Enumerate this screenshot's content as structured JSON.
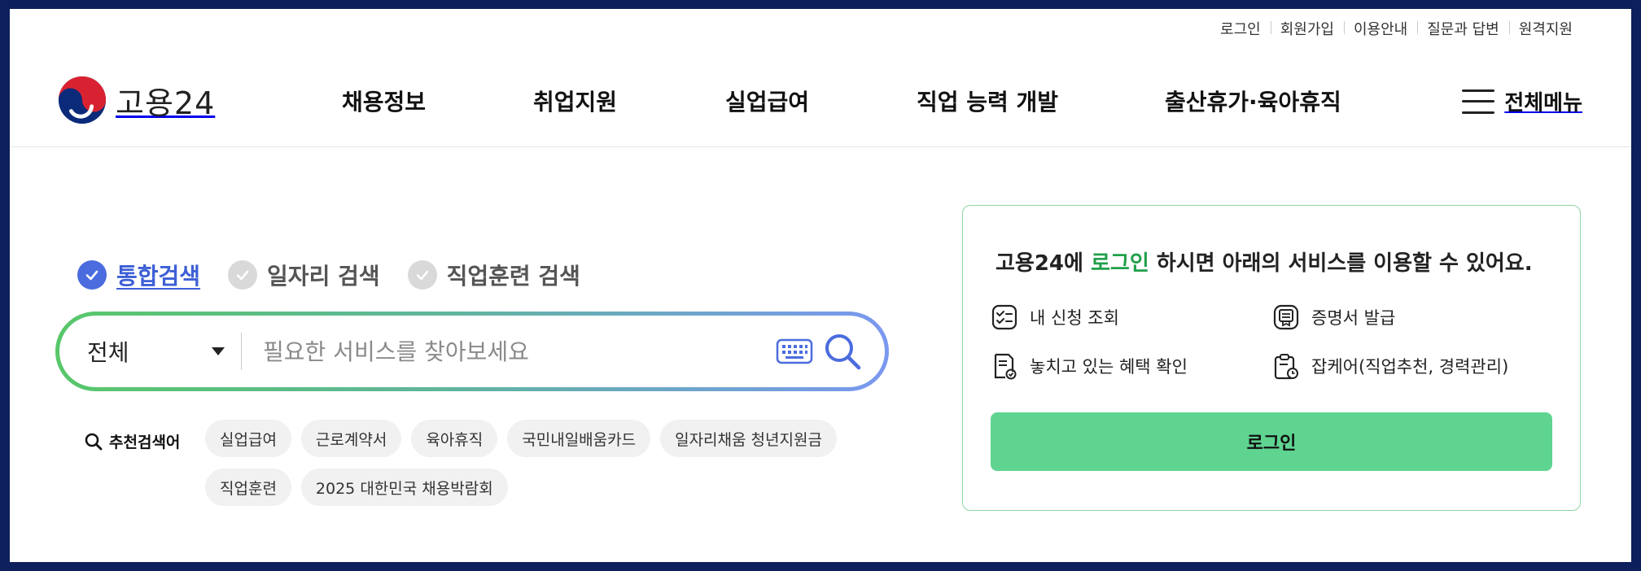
{
  "colors": {
    "frame": "#0d1f5c",
    "accent_blue": "#4b6cde",
    "accent_green": "#21a04a",
    "login_button": "#5fd491"
  },
  "utility_links": [
    "로그인",
    "회원가입",
    "이용안내",
    "질문과 답변",
    "원격지원"
  ],
  "logo": {
    "text": "고용24",
    "icon": "taegeuk-logo-icon"
  },
  "gnb": [
    "채용정보",
    "취업지원",
    "실업급여",
    "직업 능력 개발",
    "출산휴가·육아휴직"
  ],
  "menu_all": {
    "label": "전체메뉴",
    "icon": "hamburger-icon"
  },
  "search": {
    "tabs": [
      {
        "label": "통합검색",
        "active": true
      },
      {
        "label": "일자리 검색",
        "active": false
      },
      {
        "label": "직업훈련 검색",
        "active": false
      }
    ],
    "category": "전체",
    "placeholder": "필요한 서비스를 찾아보세요",
    "recommend_label": "추천검색어",
    "keywords": [
      "실업급여",
      "근로계약서",
      "육아휴직",
      "국민내일배움카드",
      "일자리채움 청년지원금",
      "직업훈련",
      "2025 대한민국 채용박람회"
    ]
  },
  "login_panel": {
    "title_before": "고용24에 ",
    "title_highlight": "로그인",
    "title_after": " 하시면 아래의 서비스를 이용할 수 있어요.",
    "services": [
      {
        "label": "내 신청 조회",
        "icon": "checklist-icon"
      },
      {
        "label": "증명서 발급",
        "icon": "certificate-icon"
      },
      {
        "label": "놓치고 있는 혜택 확인",
        "icon": "benefit-document-icon"
      },
      {
        "label": "잡케어(직업추천, 경력관리)",
        "icon": "clipboard-clock-icon"
      }
    ],
    "button_label": "로그인"
  }
}
